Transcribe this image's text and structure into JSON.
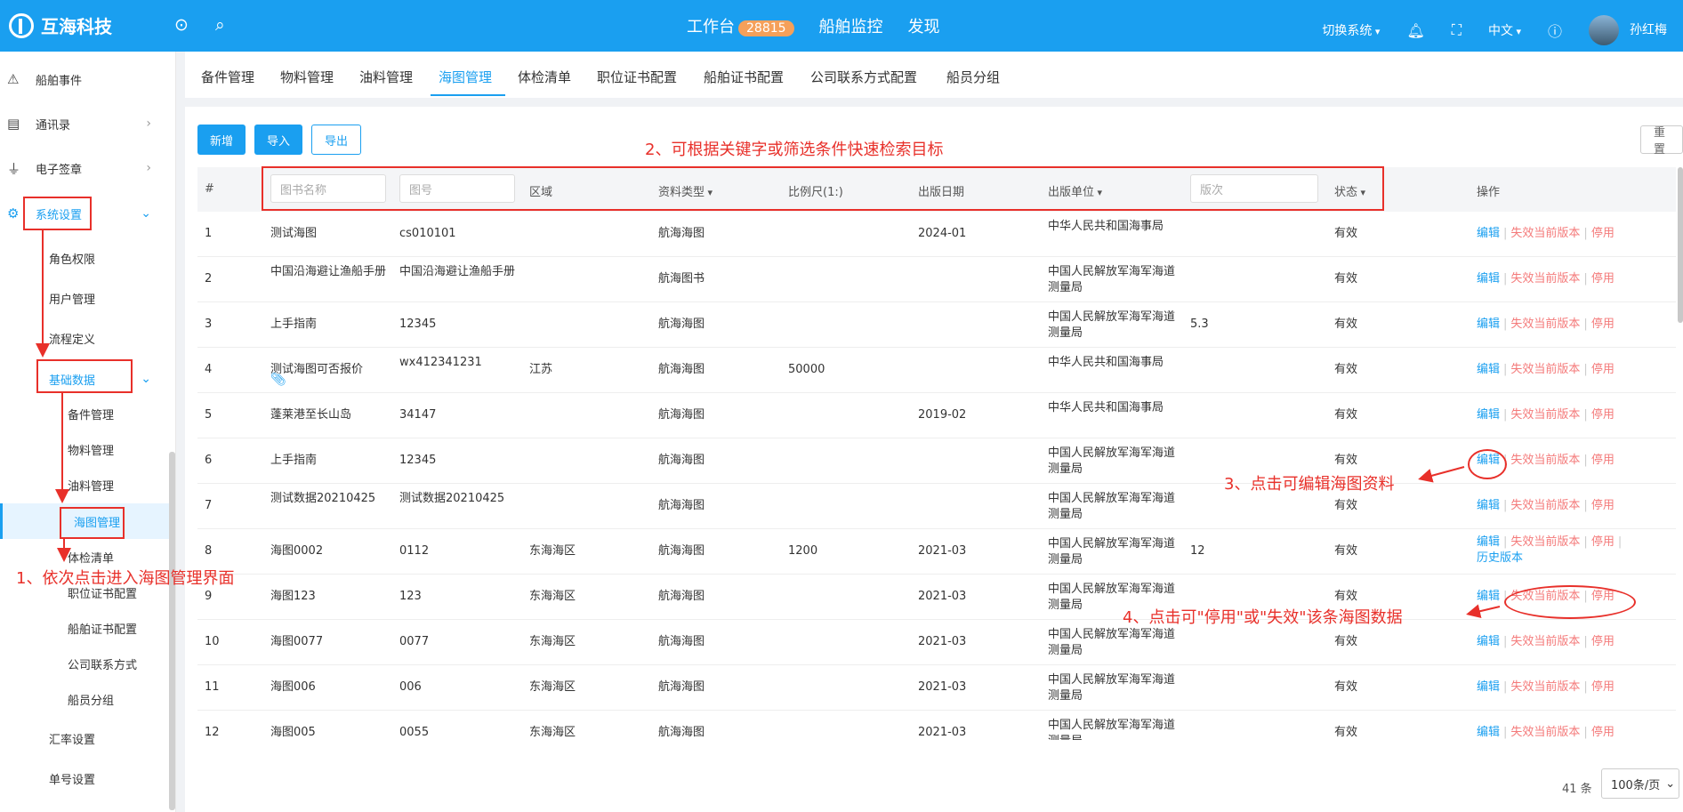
{
  "app": {
    "name": "互海科技"
  },
  "topnav": {
    "workbench": "工作台",
    "badge": "28815",
    "monitor": "船舶监控",
    "discover": "发现"
  },
  "topright": {
    "switch": "切换系统",
    "lang": "中文",
    "user": "孙红梅"
  },
  "sidebar": {
    "items": [
      {
        "label": "船舶事件",
        "icon": "warning-icon"
      },
      {
        "label": "通讯录",
        "icon": "server-icon"
      },
      {
        "label": "电子签章",
        "icon": "stamp-icon"
      },
      {
        "label": "系统设置",
        "icon": "gear-icon"
      }
    ],
    "sys_children": [
      "角色权限",
      "用户管理",
      "流程定义"
    ],
    "base": "基础数据",
    "base_children": [
      "备件管理",
      "物料管理",
      "油料管理",
      "海图管理",
      "体检清单",
      "职位证书配置",
      "船舶证书配置",
      "公司联系方式",
      "船员分组"
    ],
    "more": [
      "汇率设置",
      "单号设置"
    ]
  },
  "tabs": [
    "备件管理",
    "物料管理",
    "油料管理",
    "海图管理",
    "体检清单",
    "职位证书配置",
    "船舶证书配置",
    "公司联系方式配置",
    "船员分组"
  ],
  "toolbar": {
    "add": "新增",
    "import": "导入",
    "export": "导出",
    "reset": "重置"
  },
  "table": {
    "headers": {
      "index": "#",
      "name_ph": "图书名称",
      "no_ph": "图号",
      "region": "区域",
      "type": "资料类型",
      "scale": "比例尺(1:)",
      "date": "出版日期",
      "publisher": "出版单位",
      "edition_ph": "版次",
      "status": "状态",
      "ops": "操作"
    },
    "rows": [
      {
        "i": "1",
        "name": "测试海图",
        "no": "cs010101",
        "region": "",
        "type": "航海海图",
        "scale": "",
        "date": "2024-01",
        "pub": "中华人民共和国海事局",
        "ed": "",
        "status": "有效"
      },
      {
        "i": "2",
        "name": "中国沿海避让渔船手册",
        "no": "中国沿海避让渔船手册",
        "region": "",
        "type": "航海图书",
        "scale": "",
        "date": "",
        "pub": "中国人民解放军海军海道测量局",
        "ed": "",
        "status": "有效"
      },
      {
        "i": "3",
        "name": "上手指南",
        "no": "12345",
        "region": "",
        "type": "航海海图",
        "scale": "",
        "date": "",
        "pub": "中国人民解放军海军海道测量局",
        "ed": "5.3",
        "status": "有效"
      },
      {
        "i": "4",
        "name": "测试海图可否报价",
        "no": "wx412341231",
        "region": "江苏",
        "type": "航海海图",
        "scale": "50000",
        "date": "",
        "pub": "中华人民共和国海事局",
        "ed": "",
        "status": "有效"
      },
      {
        "i": "5",
        "name": "蓬莱港至长山岛",
        "no": "34147",
        "region": "",
        "type": "航海海图",
        "scale": "",
        "date": "2019-02",
        "pub": "中华人民共和国海事局",
        "ed": "",
        "status": "有效"
      },
      {
        "i": "6",
        "name": "上手指南",
        "no": "12345",
        "region": "",
        "type": "航海海图",
        "scale": "",
        "date": "",
        "pub": "中国人民解放军海军海道测量局",
        "ed": "",
        "status": "有效"
      },
      {
        "i": "7",
        "name": "测试数据20210425",
        "no": "测试数据20210425",
        "region": "",
        "type": "航海海图",
        "scale": "",
        "date": "",
        "pub": "中国人民解放军海军海道测量局",
        "ed": "",
        "status": "有效"
      },
      {
        "i": "8",
        "name": "海图0002",
        "no": "0112",
        "region": "东海海区",
        "type": "航海海图",
        "scale": "1200",
        "date": "2021-03",
        "pub": "中国人民解放军海军海道测量局",
        "ed": "12",
        "status": "有效"
      },
      {
        "i": "9",
        "name": "海图123",
        "no": "123",
        "region": "东海海区",
        "type": "航海海图",
        "scale": "",
        "date": "2021-03",
        "pub": "中国人民解放军海军海道测量局",
        "ed": "",
        "status": "有效"
      },
      {
        "i": "10",
        "name": "海图0077",
        "no": "0077",
        "region": "东海海区",
        "type": "航海海图",
        "scale": "",
        "date": "2021-03",
        "pub": "中国人民解放军海军海道测量局",
        "ed": "",
        "status": "有效"
      },
      {
        "i": "11",
        "name": "海图006",
        "no": "006",
        "region": "东海海区",
        "type": "航海海图",
        "scale": "",
        "date": "2021-03",
        "pub": "中国人民解放军海军海道测量局",
        "ed": "",
        "status": "有效"
      },
      {
        "i": "12",
        "name": "海图005",
        "no": "0055",
        "region": "东海海区",
        "type": "航海海图",
        "scale": "",
        "date": "2021-03",
        "pub": "中国人民解放军海军海道测量局",
        "ed": "",
        "status": "有效"
      }
    ],
    "actions": {
      "edit": "编辑",
      "invalidate": "失效当前版本",
      "disable": "停用",
      "history": "历史版本"
    }
  },
  "footer": {
    "total": "41 条",
    "page_size": "100条/页"
  },
  "annotations": {
    "a1": "1、依次点击进入海图管理界面",
    "a2": "2、可根据关键字或筛选条件快速检索目标",
    "a3": "3、点击可编辑海图资料",
    "a4": "4、点击可\"停用\"或\"失效\"该条海图数据"
  },
  "colors": {
    "primary": "#1a9ff0",
    "annotation": "#e8302a",
    "danger_link": "#f47a7a",
    "badge": "#f5a05a"
  }
}
